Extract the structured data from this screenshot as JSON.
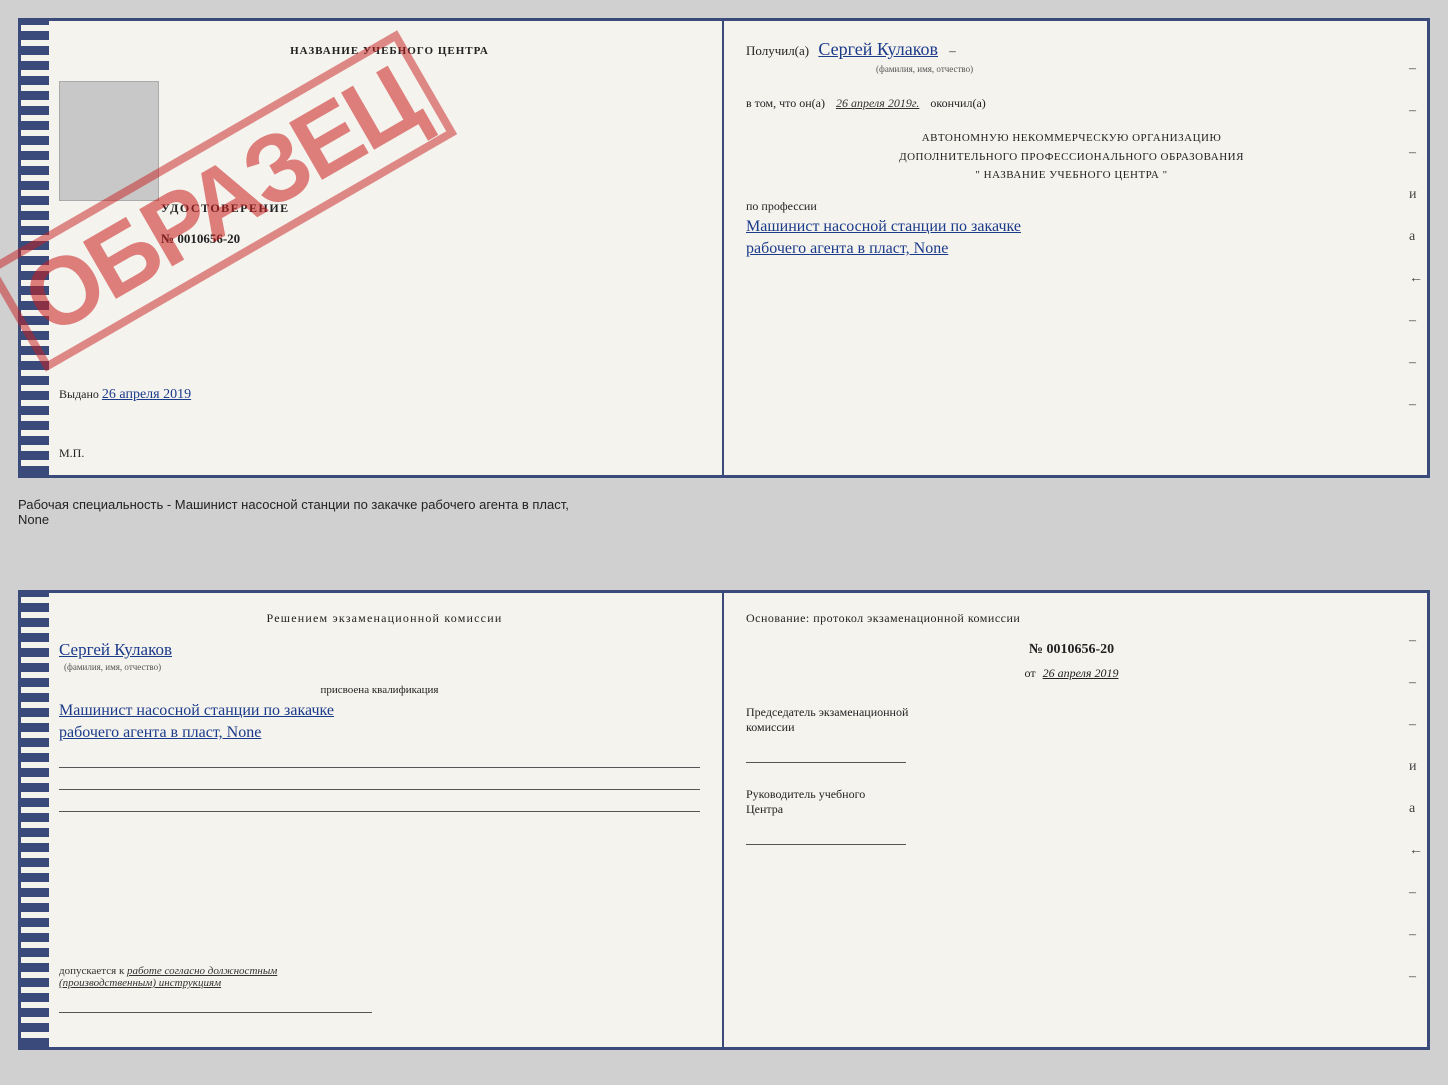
{
  "page": {
    "background": "#d0d0d0"
  },
  "top_doc": {
    "left": {
      "header": "НАЗВАНИЕ УЧЕБНОГО ЦЕНТРА",
      "udostoverenie": "УДОСТОВЕРЕНИЕ",
      "number": "№ 0010656-20",
      "vydano_label": "Выдано",
      "vydano_date": "26 апреля 2019",
      "mp": "М.П.",
      "stamp": "ОБРАЗЕЦ"
    },
    "right": {
      "poluchil_prefix": "Получил(а)",
      "recipient_name": "Сергей Кулаков",
      "fio_hint": "(фамилия, имя, отчество)",
      "vtom_prefix": "в том, что он(а)",
      "date_value": "26 апреля 2019г.",
      "okonchil": "окончил(а)",
      "org_line1": "АВТОНОМНУЮ НЕКОММЕРЧЕСКУЮ ОРГАНИЗАЦИЮ",
      "org_line2": "ДОПОЛНИТЕЛЬНОГО ПРОФЕССИОНАЛЬНОГО ОБРАЗОВАНИЯ",
      "org_line3": "\"   НАЗВАНИЕ УЧЕБНОГО ЦЕНТРА   \"",
      "po_professii": "по профессии",
      "profession1": "Машинист насосной станции по закачке",
      "profession2": "рабочего агента в пласт, None",
      "dash1": "–",
      "dash2": "–",
      "dash3": "–",
      "dash4": "и",
      "dash5": "а",
      "dash6": "←",
      "dash7": "–",
      "dash8": "–",
      "dash9": "–"
    }
  },
  "separator": {
    "text": "Рабочая специальность - Машинист насосной станции по закачке рабочего агента в пласт,",
    "text2": "None"
  },
  "bottom_doc": {
    "left": {
      "header": "Решением экзаменационной комиссии",
      "name": "Сергей Кулаков",
      "fio_hint": "(фамилия, имя, отчество)",
      "prisvoena": "присвоена квалификация",
      "kval1": "Машинист насосной станции по закачке",
      "kval2": "рабочего агента в пласт, None",
      "dopusk_prefix": "допускается к",
      "dopusk_italic": "работе согласно должностным",
      "dopusk_italic2": "(производственным) инструкциям"
    },
    "right": {
      "osnov_header": "Основание: протокол экзаменационной комиссии",
      "protocol_no": "№ 0010656-20",
      "protocol_ot": "от",
      "protocol_date": "26 апреля 2019",
      "predsedatel_label": "Председатель экзаменационной",
      "predsedatel_label2": "комиссии",
      "rukovoditel_label": "Руководитель учебного",
      "rukovoditel_label2": "Центра",
      "dash1": "–",
      "dash2": "–",
      "dash3": "–",
      "dash4": "и",
      "dash5": "а",
      "dash6": "←",
      "dash7": "–",
      "dash8": "–",
      "dash9": "–"
    }
  }
}
